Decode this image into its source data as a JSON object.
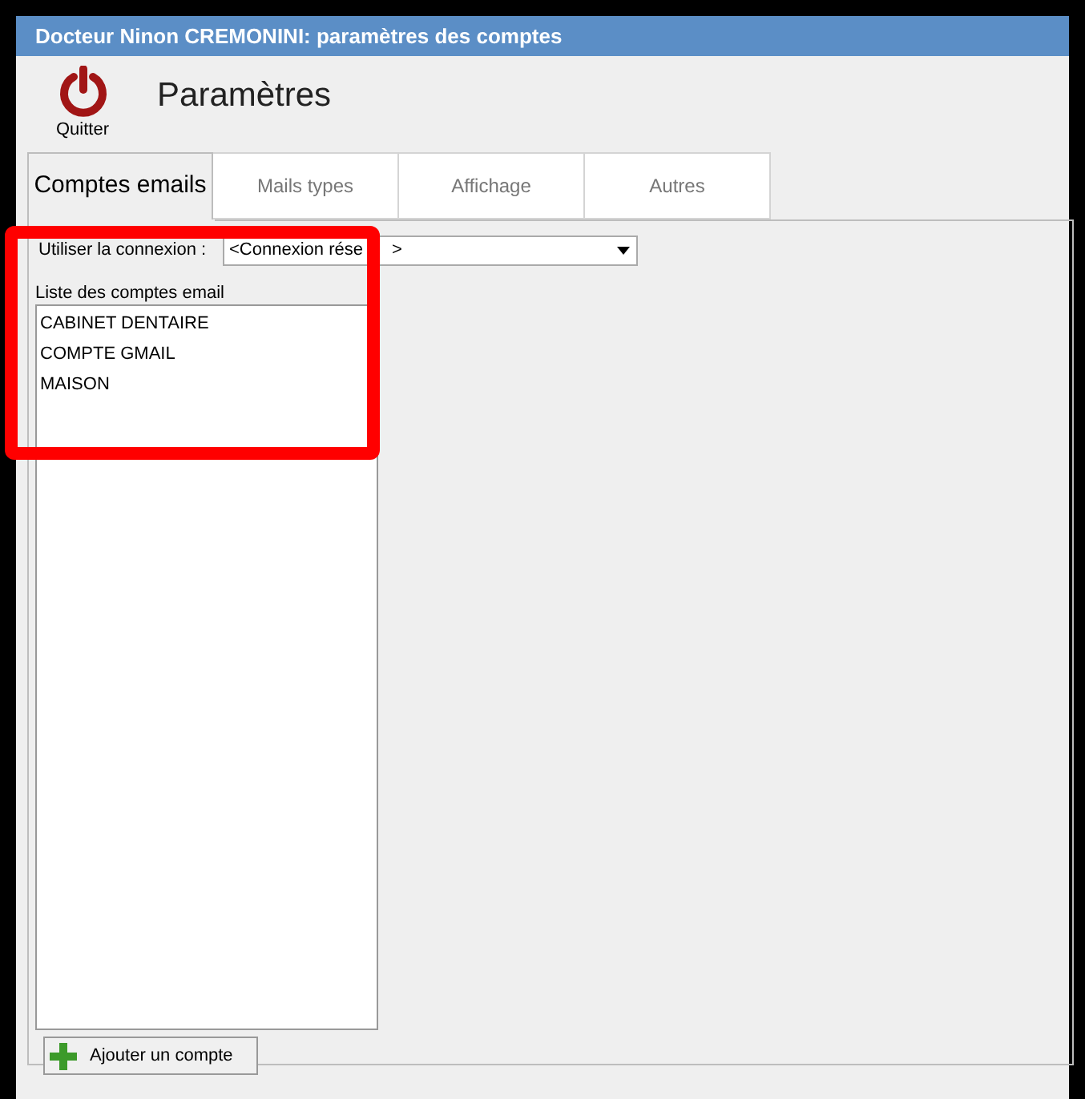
{
  "window": {
    "title": "Docteur Ninon CREMONINI: paramètres des comptes"
  },
  "toolbar": {
    "quit_label": "Quitter",
    "heading": "Paramètres"
  },
  "tabs": [
    {
      "label": "Comptes emails",
      "selected": true
    },
    {
      "label": "Mails types",
      "selected": false
    },
    {
      "label": "Affichage",
      "selected": false
    },
    {
      "label": "Autres",
      "selected": false
    }
  ],
  "connection": {
    "label": "Utiliser la connexion :",
    "value_start": "<Connexion rése",
    "value_end": ">"
  },
  "accounts": {
    "label": "Liste des comptes email",
    "items": [
      "CABINET DENTAIRE",
      "COMPTE GMAIL",
      "MAISON"
    ]
  },
  "add_button": {
    "label": "Ajouter un compte"
  }
}
